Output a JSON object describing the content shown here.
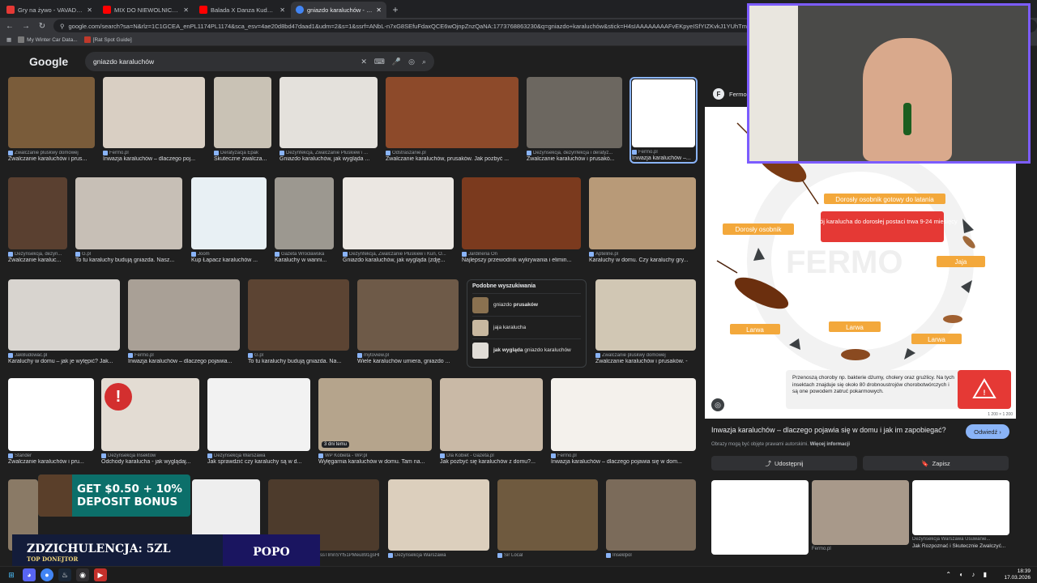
{
  "tabs": [
    {
      "title": "Gry na żywo - VAVADA Online",
      "color": "#e53935"
    },
    {
      "title": "MIX DO NIEWOLNICZEJ PRACY",
      "color": "#ff0000"
    },
    {
      "title": "Balada X Danza Kuduro X She",
      "color": "#ff0000"
    },
    {
      "title": "gniazdo karaluchów - Szukaj w",
      "color": "#4285f4"
    }
  ],
  "address": {
    "url": "google.com/search?sa=N&rlz=1C1GCEA_enPL1174PL1174&sca_esv=4ae20d8bd47daad1&udm=2&s=1&ssrf=ANbL-n7xG8SEfuFdaxQCE6wOjnpZnzQaNA:1773768863230&q=gniazdo+karaluchów&stick=H4sIAAAAAAAAFvEKpyeISfYIZKvkJ1YUhTmpixeHM5AP3RpDYWAA"
  },
  "bookmarks": [
    "My Winter Car Data...",
    "[Rat Spot Guide]"
  ],
  "google": {
    "logo": "Google",
    "query": "gniazdo karaluchów"
  },
  "related": {
    "title": "Podobne wyszukiwania",
    "items": [
      {
        "pre": "gniazdo ",
        "bold": "prusaków"
      },
      {
        "pre": "jaja karalucha",
        "bold": ""
      },
      {
        "pre": "jak wygląda ",
        "bold": "gniazdo karaluchów"
      }
    ]
  },
  "results": [
    {
      "src": "Zwalczanie pluskwy domowej",
      "cap": "Zwalczanie karaluchów i prus..."
    },
    {
      "src": "Fermo.pl",
      "cap": "Inwazja karaluchów – dlaczego poj..."
    },
    {
      "src": "Deratyzacja Epak",
      "cap": "Skuteczne zwalcza..."
    },
    {
      "src": "Dezynfekcja, Zwalczanie Pluskiew i ...",
      "cap": "Gniazdo karaluchów, jak wygląda ..."
    },
    {
      "src": "Odstraszanie.pl",
      "cap": "Zwalczanie karaluchów, prusaków. Jak pozbyć ..."
    },
    {
      "src": "Dezynsekcja, dezynfekcja i deratyz...",
      "cap": "Zwalczanie karaluchów i prusakó..."
    },
    {
      "src": "Fermo.pl",
      "cap": "Inwazja karaluchów –..."
    },
    {
      "src": "Dezynsekcja, dezyn...",
      "cap": "Zwalczanie karaluc..."
    },
    {
      "src": "G.pl",
      "cap": "To tu karaluchy budują gniazda. Nasz..."
    },
    {
      "src": "Joom",
      "cap": "Kup Łapacz karaluchów ..."
    },
    {
      "src": "Gazeta Wrocławska",
      "cap": "Karaluchy w wanni..."
    },
    {
      "src": "Dezynfekcja, Zwalczanie Pluskiew i Kun, O...",
      "cap": "Gniazdo karaluchów, jak wygląda (zdję..."
    },
    {
      "src": "Jardineria On",
      "cap": "Najlepszy przewodnik wykrywania i elimin..."
    },
    {
      "src": "Apteline.pl",
      "cap": "Karaluchy w domu. Czy karaluchy gry..."
    },
    {
      "src": "JakBudowac.pl",
      "cap": "Karaluchy w domu – jak je wytępić? Jak..."
    },
    {
      "src": "Fermo.pl",
      "cap": "Inwazja karaluchów – dlaczego pojawia..."
    },
    {
      "src": "G.pl",
      "cap": "To tu karaluchy budują gniazda. Na..."
    },
    {
      "src": "mytoview.pl",
      "cap": "Wiele karaluchów umiera, gniazdo ..."
    },
    {
      "src": "Zwalczanie pluskwy domowej",
      "cap": "Zwalczanie karaluchów i prusaków. -"
    },
    {
      "src": "Stander",
      "cap": "Zwalczanie karaluchów i pru..."
    },
    {
      "src": "Dezynsekcja Insektów",
      "cap": "Odchody karalucha - jak wyglądaj..."
    },
    {
      "src": "Dezynsekcja Warszawa",
      "cap": "Jak sprawdzić czy karaluchy są w d..."
    },
    {
      "src": "WP Kobieta - WP.pl",
      "cap": "Wyłęgarnia karaluchów w domu. Tam na..."
    },
    {
      "src": "Dla Kobiet - Gazeta.pl",
      "cap": "Jak pozbyć się karaluchów z domu?..."
    },
    {
      "src": "Fermo.pl",
      "cap": "Inwazja karaluchów – dlaczego pojawia się w dom..."
    },
    {
      "src": "Dezynsekcja Warszawa",
      "cap": ""
    },
    {
      "src": "Sir Local",
      "cap": ""
    },
    {
      "src": "Inseklpol",
      "cap": ""
    },
    {
      "src": "ssTlmnSYf51PMeu891gsHk8798",
      "cap": ""
    }
  ],
  "badge_3d": "3 dni temu",
  "panel": {
    "site": "Fermo.pl",
    "title": "Inwazja karaluchów – dlaczego pojawia się w domu i jak im zapobiegać?",
    "visit": "Odwiedź",
    "note": "Obrazy mogą być objęte prawami autorskimi.",
    "note_link": "Więcej informacji",
    "share": "Udostępnij",
    "save": "Zapisz",
    "size_badge": "1 200 × 1 200",
    "diagram": {
      "adult_flying": "Dorosły osobnik gotowy do latania",
      "development": "rozwój karalucha do dorosłej postaci trwa 9-24 miesięcy",
      "adult": "Dorosły osobnik",
      "eggs": "Jaja",
      "larva1": "Larwa",
      "larva2": "Larwa",
      "larva3": "Larwa",
      "warning": "Przenoszą choroby np. bakterie dżumy, cholery oraz grużlicy. Na tych insektach znajduje się około 80 drobnoustrojów chorobotwórczych i są one powodem zatruć pokarmowych.",
      "watermark": "FERMO"
    },
    "thumbs": [
      {
        "src": "",
        "cap": ""
      },
      {
        "src": "Fermo.pl",
        "cap": ""
      },
      {
        "src": "Dezynsekcja Warszawa Usuwanie...",
        "cap": "Jak Rozpoznać i Skutecznie Zwalczyć..."
      }
    ]
  },
  "overlays": {
    "promo": "GET $0.50 + 10% DEPOSIT BONUS",
    "donor_name": "ZDZICHULENCJA: 5ZL",
    "donor_label": "TOP DONEJTOR",
    "right_name": "POPO"
  },
  "clock": {
    "time": "18:39",
    "date": "17.03.2026"
  }
}
